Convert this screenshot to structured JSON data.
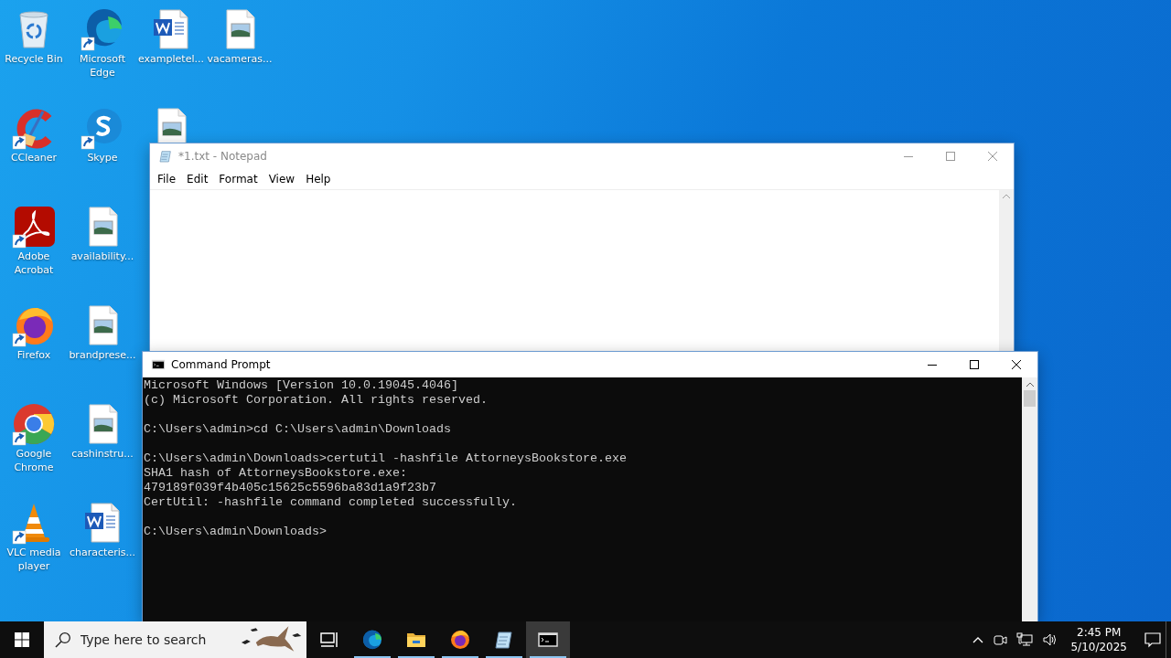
{
  "desktop": {
    "columns": [
      [
        {
          "label": "Recycle Bin",
          "kind": "recycle-bin",
          "shortcut": false
        },
        {
          "label": "CCleaner",
          "kind": "ccleaner",
          "shortcut": true
        },
        {
          "label": "Adobe Acrobat",
          "kind": "acrobat",
          "shortcut": true
        },
        {
          "label": "Firefox",
          "kind": "firefox",
          "shortcut": true
        },
        {
          "label": "Google Chrome",
          "kind": "chrome",
          "shortcut": true
        },
        {
          "label": "VLC media player",
          "kind": "vlc",
          "shortcut": true
        }
      ],
      [
        {
          "label": "Microsoft Edge",
          "kind": "edge",
          "shortcut": true
        },
        {
          "label": "Skype",
          "kind": "skype",
          "shortcut": true
        },
        {
          "label": "availability...",
          "kind": "image",
          "shortcut": false
        },
        {
          "label": "brandprese...",
          "kind": "image",
          "shortcut": false
        },
        {
          "label": "cashinstru...",
          "kind": "image",
          "shortcut": false
        },
        {
          "label": "characteris...",
          "kind": "word",
          "shortcut": false
        }
      ],
      [
        {
          "label": "exampletel...",
          "kind": "word",
          "shortcut": false
        },
        {
          "kind": "image",
          "shortcut": false
        }
      ],
      [
        {
          "label": "vacameras...",
          "kind": "image",
          "shortcut": false
        }
      ]
    ]
  },
  "notepad": {
    "title": "*1.txt - Notepad",
    "active": false,
    "menu": [
      "File",
      "Edit",
      "Format",
      "View",
      "Help"
    ]
  },
  "command_prompt": {
    "title": "Command Prompt",
    "active": true,
    "blocks": [
      [
        "Microsoft Windows [Version 10.0.19045.4046]",
        "(c) Microsoft Corporation. All rights reserved."
      ],
      [
        "C:\\Users\\admin>cd C:\\Users\\admin\\Downloads"
      ],
      [
        "C:\\Users\\admin\\Downloads>certutil -hashfile AttorneysBookstore.exe",
        "SHA1 hash of AttorneysBookstore.exe:",
        "479189f039f4b405c15625c5596ba83d1a9f23b7",
        "CertUtil: -hashfile command completed successfully."
      ],
      [
        "C:\\Users\\admin\\Downloads>"
      ]
    ]
  },
  "taskbar": {
    "search": {
      "placeholder": "Type here to search"
    },
    "apps": [
      {
        "kind": "task-view",
        "running": false,
        "selected": false
      },
      {
        "kind": "edge",
        "running": true,
        "selected": false
      },
      {
        "kind": "folder",
        "running": true,
        "selected": false
      },
      {
        "kind": "firefox",
        "running": true,
        "selected": false
      },
      {
        "kind": "notepad",
        "running": true,
        "selected": false
      },
      {
        "kind": "terminal",
        "running": true,
        "selected": true
      }
    ],
    "clock": {
      "time": "2:45 PM",
      "date": "5/10/2025"
    }
  }
}
